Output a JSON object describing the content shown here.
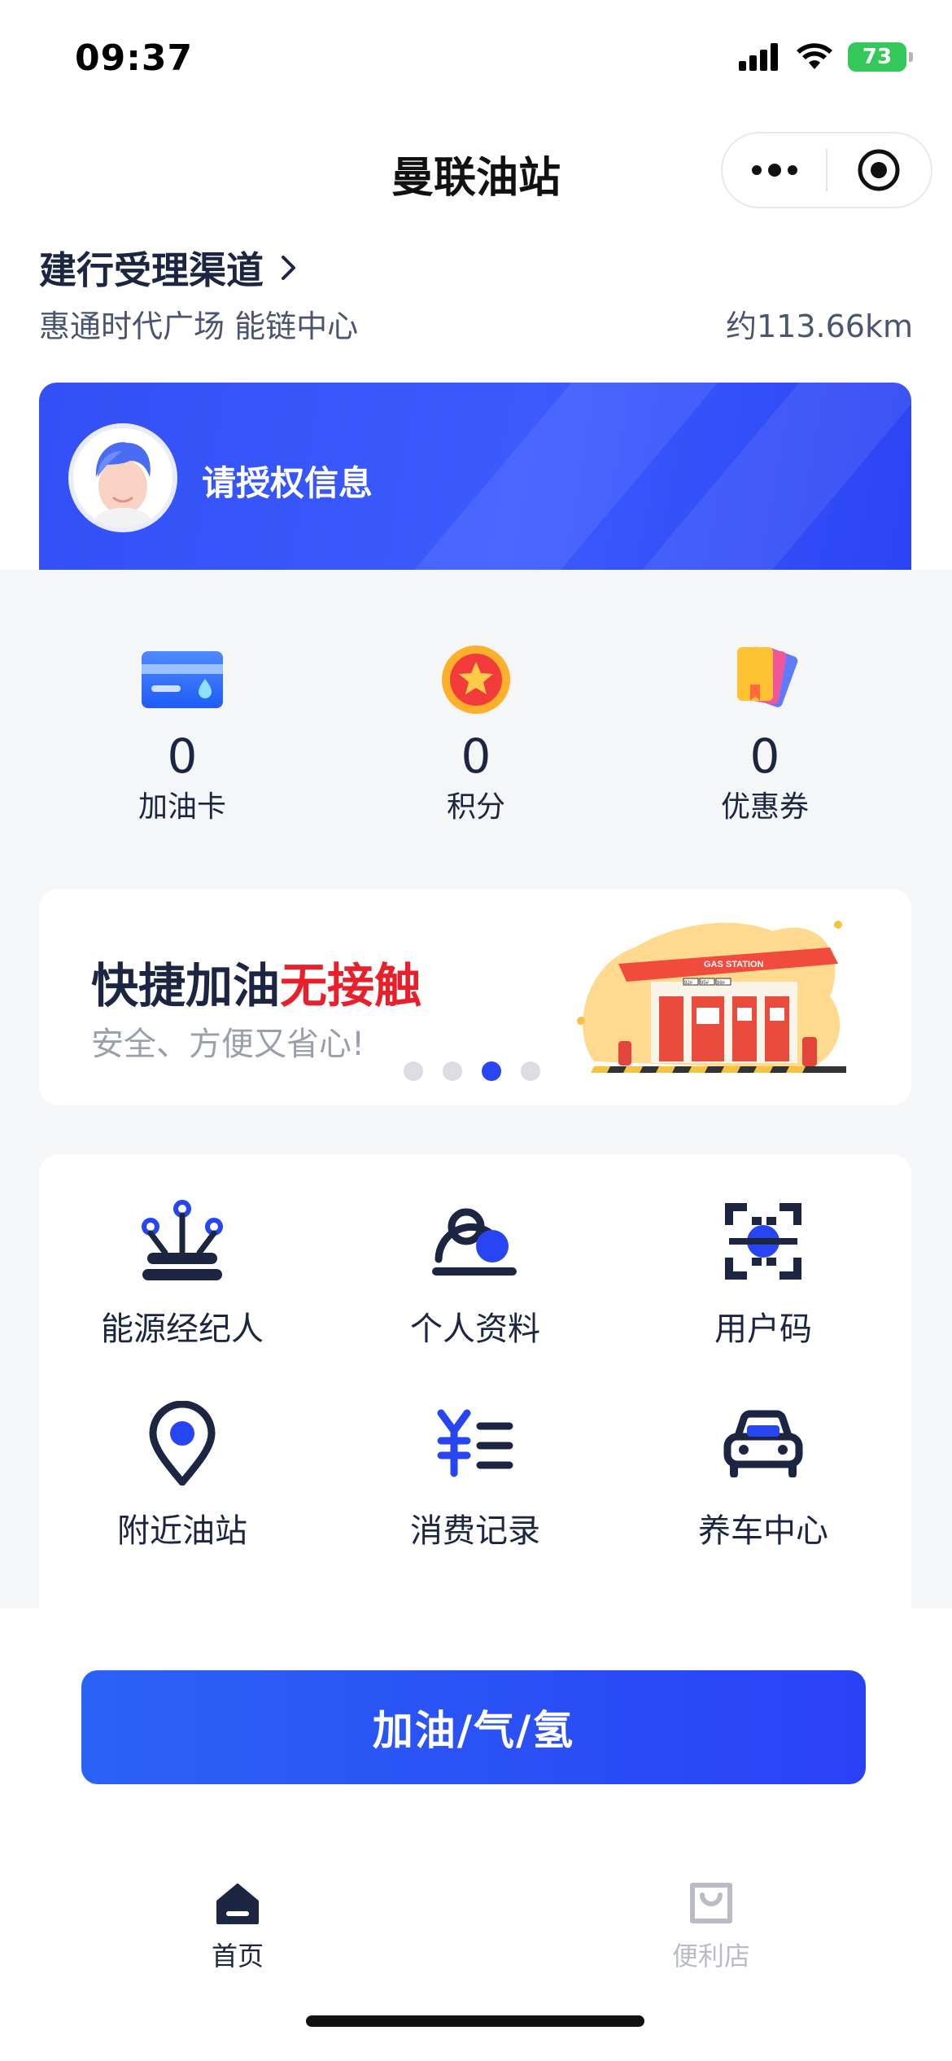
{
  "status_bar": {
    "time": "09:37",
    "battery": "73"
  },
  "nav": {
    "title": "曼联油站"
  },
  "station": {
    "channel": "建行受理渠道",
    "name": "惠通时代广场 能链中心",
    "distance": "约113.66km"
  },
  "auth": {
    "prompt": "请授权信息"
  },
  "stats": [
    {
      "value": "0",
      "label": "加油卡",
      "icon": "fuel-card-icon"
    },
    {
      "value": "0",
      "label": "积分",
      "icon": "points-star-icon"
    },
    {
      "value": "0",
      "label": "优惠券",
      "icon": "coupon-icon"
    }
  ],
  "banner": {
    "headline_main": "快捷加油",
    "headline_accent": "无接触",
    "subtitle": "安全、方便又省心!",
    "art_sign": "GAS STATION",
    "art_prices": [
      "92#",
      "95#",
      "98#"
    ],
    "slides": 4,
    "active_slide": 3,
    "colors": {
      "accent": "#e8202c",
      "dot_active": "#2745f2"
    }
  },
  "grid": [
    {
      "label": "能源经纪人",
      "icon": "energy-broker-icon"
    },
    {
      "label": "个人资料",
      "icon": "profile-icon"
    },
    {
      "label": "用户码",
      "icon": "user-code-scan-icon"
    },
    {
      "label": "附近油站",
      "icon": "location-pin-icon"
    },
    {
      "label": "消费记录",
      "icon": "consumption-record-icon"
    },
    {
      "label": "养车中心",
      "icon": "car-icon"
    }
  ],
  "primary_button": {
    "label": "加油/气/氢"
  },
  "tabbar": [
    {
      "label": "首页",
      "active": true,
      "icon": "home-icon"
    },
    {
      "label": "便利店",
      "active": false,
      "icon": "shopping-bag-icon"
    }
  ],
  "theme": {
    "primary": "#2a45f5",
    "text": "#1c2541",
    "inactive": "#b9bcc4"
  }
}
